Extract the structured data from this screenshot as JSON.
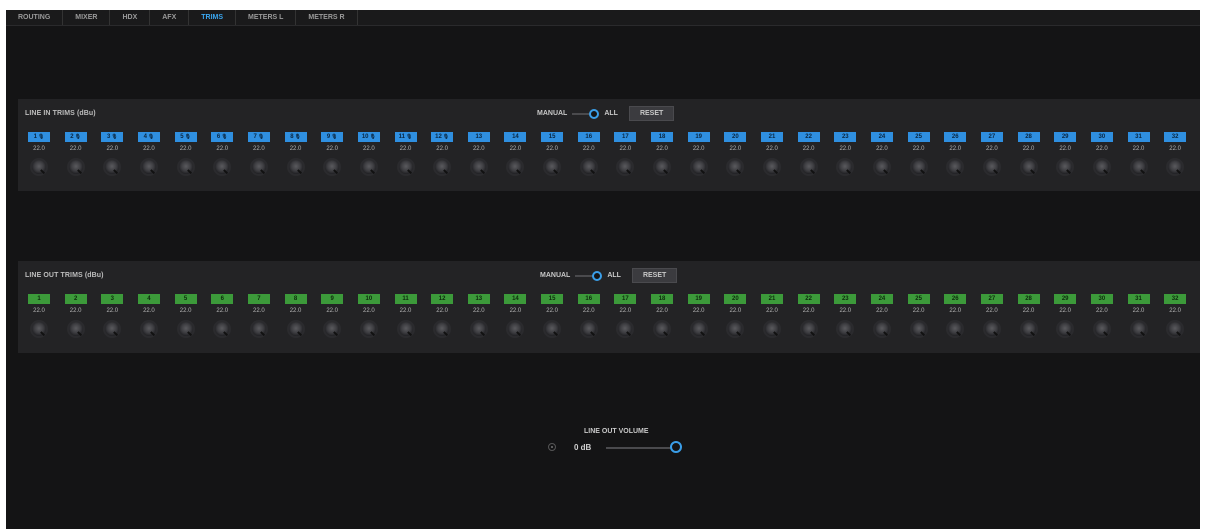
{
  "tabs": [
    {
      "label": "ROUTING",
      "active": false
    },
    {
      "label": "MIXER",
      "active": false
    },
    {
      "label": "HDX",
      "active": false
    },
    {
      "label": "AFX",
      "active": false
    },
    {
      "label": "TRIMS",
      "active": true
    },
    {
      "label": "METERS L",
      "active": false
    },
    {
      "label": "METERS R",
      "active": false
    }
  ],
  "line_in": {
    "title": "LINE IN TRIMS (dBu)",
    "mode_manual": "MANUAL",
    "mode_all": "ALL",
    "reset": "RESET",
    "channels": [
      {
        "n": "1",
        "v": "22.0",
        "mic": true
      },
      {
        "n": "2",
        "v": "22.0",
        "mic": true
      },
      {
        "n": "3",
        "v": "22.0",
        "mic": true
      },
      {
        "n": "4",
        "v": "22.0",
        "mic": true
      },
      {
        "n": "5",
        "v": "22.0",
        "mic": true
      },
      {
        "n": "6",
        "v": "22.0",
        "mic": true
      },
      {
        "n": "7",
        "v": "22.0",
        "mic": true
      },
      {
        "n": "8",
        "v": "22.0",
        "mic": true
      },
      {
        "n": "9",
        "v": "22.0",
        "mic": true
      },
      {
        "n": "10",
        "v": "22.0",
        "mic": true
      },
      {
        "n": "11",
        "v": "22.0",
        "mic": true
      },
      {
        "n": "12",
        "v": "22.0",
        "mic": true
      },
      {
        "n": "13",
        "v": "22.0",
        "mic": false
      },
      {
        "n": "14",
        "v": "22.0",
        "mic": false
      },
      {
        "n": "15",
        "v": "22.0",
        "mic": false
      },
      {
        "n": "16",
        "v": "22.0",
        "mic": false
      },
      {
        "n": "17",
        "v": "22.0",
        "mic": false
      },
      {
        "n": "18",
        "v": "22.0",
        "mic": false
      },
      {
        "n": "19",
        "v": "22.0",
        "mic": false
      },
      {
        "n": "20",
        "v": "22.0",
        "mic": false
      },
      {
        "n": "21",
        "v": "22.0",
        "mic": false
      },
      {
        "n": "22",
        "v": "22.0",
        "mic": false
      },
      {
        "n": "23",
        "v": "22.0",
        "mic": false
      },
      {
        "n": "24",
        "v": "22.0",
        "mic": false
      },
      {
        "n": "25",
        "v": "22.0",
        "mic": false
      },
      {
        "n": "26",
        "v": "22.0",
        "mic": false
      },
      {
        "n": "27",
        "v": "22.0",
        "mic": false
      },
      {
        "n": "28",
        "v": "22.0",
        "mic": false
      },
      {
        "n": "29",
        "v": "22.0",
        "mic": false
      },
      {
        "n": "30",
        "v": "22.0",
        "mic": false
      },
      {
        "n": "31",
        "v": "22.0",
        "mic": false
      },
      {
        "n": "32",
        "v": "22.0",
        "mic": false
      }
    ]
  },
  "line_out": {
    "title": "LINE OUT TRIMS (dBu)",
    "mode_manual": "MANUAL",
    "mode_all": "ALL",
    "reset": "RESET",
    "channels": [
      {
        "n": "1",
        "v": "22.0"
      },
      {
        "n": "2",
        "v": "22.0"
      },
      {
        "n": "3",
        "v": "22.0"
      },
      {
        "n": "4",
        "v": "22.0"
      },
      {
        "n": "5",
        "v": "22.0"
      },
      {
        "n": "6",
        "v": "22.0"
      },
      {
        "n": "7",
        "v": "22.0"
      },
      {
        "n": "8",
        "v": "22.0"
      },
      {
        "n": "9",
        "v": "22.0"
      },
      {
        "n": "10",
        "v": "22.0"
      },
      {
        "n": "11",
        "v": "22.0"
      },
      {
        "n": "12",
        "v": "22.0"
      },
      {
        "n": "13",
        "v": "22.0"
      },
      {
        "n": "14",
        "v": "22.0"
      },
      {
        "n": "15",
        "v": "22.0"
      },
      {
        "n": "16",
        "v": "22.0"
      },
      {
        "n": "17",
        "v": "22.0"
      },
      {
        "n": "18",
        "v": "22.0"
      },
      {
        "n": "19",
        "v": "22.0"
      },
      {
        "n": "20",
        "v": "22.0"
      },
      {
        "n": "21",
        "v": "22.0"
      },
      {
        "n": "22",
        "v": "22.0"
      },
      {
        "n": "23",
        "v": "22.0"
      },
      {
        "n": "24",
        "v": "22.0"
      },
      {
        "n": "25",
        "v": "22.0"
      },
      {
        "n": "26",
        "v": "22.0"
      },
      {
        "n": "27",
        "v": "22.0"
      },
      {
        "n": "28",
        "v": "22.0"
      },
      {
        "n": "29",
        "v": "22.0"
      },
      {
        "n": "30",
        "v": "22.0"
      },
      {
        "n": "31",
        "v": "22.0"
      },
      {
        "n": "32",
        "v": "22.0"
      }
    ]
  },
  "volume": {
    "title": "LINE OUT VOLUME",
    "value": "0 dB"
  },
  "colors": {
    "accent": "#3aa6f0",
    "in_badge": "#2f8fe0",
    "out_badge": "#3c9a3a"
  }
}
